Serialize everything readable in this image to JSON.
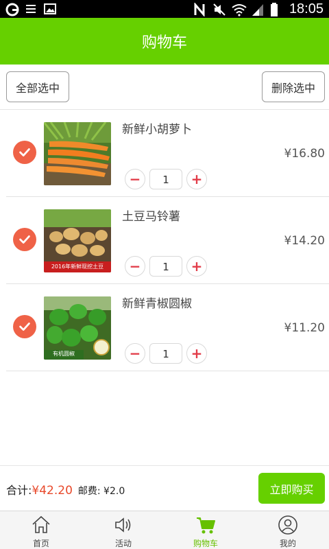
{
  "status_bar": {
    "time": "18:05",
    "icons": [
      "browser-icon",
      "menu-icon",
      "image-icon",
      "nfc-icon",
      "mute-icon",
      "wifi-icon",
      "signal-icon",
      "battery-icon"
    ]
  },
  "header": {
    "title": "购物车"
  },
  "toolbar": {
    "select_all_label": "全部选中",
    "delete_selected_label": "删除选中"
  },
  "cart": {
    "items": [
      {
        "name": "新鲜小胡萝卜",
        "price": "¥16.80",
        "quantity": "1",
        "checked": true,
        "image": "carrots-image"
      },
      {
        "name": "土豆马铃薯",
        "price": "¥14.20",
        "quantity": "1",
        "checked": true,
        "image": "potatoes-image",
        "image_caption": "2016年新鲜现挖土豆"
      },
      {
        "name": "新鲜青椒圆椒",
        "price": "¥11.20",
        "quantity": "1",
        "checked": true,
        "image": "green-peppers-image",
        "image_caption": "有机圆椒"
      }
    ],
    "minus_label": "−",
    "plus_label": "+"
  },
  "summary": {
    "total_label": "合计:",
    "total_value": "¥42.20",
    "shipping_label": "邮费: ¥2.0",
    "buy_label": "立即购买"
  },
  "tabbar": {
    "tabs": [
      {
        "label": "首页",
        "icon": "home-icon",
        "active": false
      },
      {
        "label": "活动",
        "icon": "speaker-icon",
        "active": false
      },
      {
        "label": "购物车",
        "icon": "cart-icon",
        "active": true
      },
      {
        "label": "我的",
        "icon": "user-icon",
        "active": false
      }
    ]
  },
  "colors": {
    "accent": "#66d000",
    "check": "#ef6247",
    "price_total": "#e8492b",
    "qty_button": "#e23b48"
  }
}
